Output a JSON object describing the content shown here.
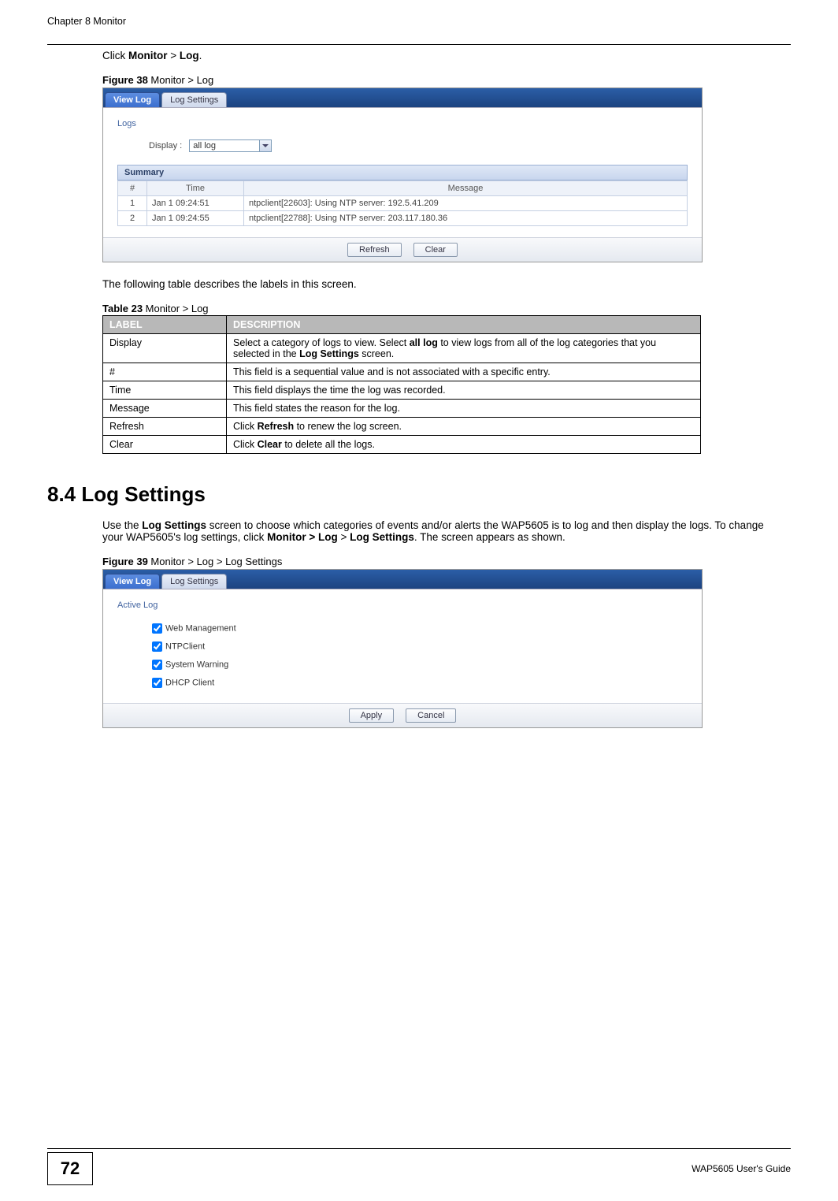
{
  "header": {
    "chapter": "Chapter 8 Monitor"
  },
  "intro": {
    "click_text_prefix": "Click ",
    "click_text_bold1": "Monitor",
    "click_text_mid": " > ",
    "click_text_bold2": "Log",
    "click_text_suffix": "."
  },
  "figure38": {
    "label_prefix": "Figure 38",
    "label_rest": "   Monitor > Log",
    "tabs": {
      "view_log": "View Log",
      "log_settings": "Log Settings"
    },
    "section": "Logs",
    "display_label": "Display :",
    "display_value": "all log",
    "summary": "Summary",
    "columns": {
      "num": "#",
      "time": "Time",
      "message": "Message"
    },
    "rows": [
      {
        "n": "1",
        "time": "Jan 1 09:24:51",
        "msg": "ntpclient[22603]: Using NTP server: 192.5.41.209"
      },
      {
        "n": "2",
        "time": "Jan 1 09:24:55",
        "msg": "ntpclient[22788]: Using NTP server: 203.117.180.36"
      }
    ],
    "buttons": {
      "refresh": "Refresh",
      "clear": "Clear"
    }
  },
  "table_intro": "The following table describes the labels in this screen.",
  "table23": {
    "caption_prefix": "Table 23",
    "caption_rest": "   Monitor > Log",
    "head_label": "LABEL",
    "head_desc": "DESCRIPTION",
    "rows": [
      {
        "label": "Display",
        "desc_pre": "Select a category of logs to view. Select ",
        "desc_b1": "all log",
        "desc_mid": " to view logs from all of the log categories that you selected in the ",
        "desc_b2": "Log Settings",
        "desc_post": " screen."
      },
      {
        "label": "#",
        "desc": "This field is a sequential value and is not associated with a specific entry."
      },
      {
        "label": "Time",
        "desc": "This field displays the time the log was recorded."
      },
      {
        "label": "Message",
        "desc": "This field states the reason for the log."
      },
      {
        "label": "Refresh",
        "desc_pre": "Click ",
        "desc_b1": "Refresh",
        "desc_post": " to renew the log screen."
      },
      {
        "label": "Clear",
        "desc_pre": "Click ",
        "desc_b1": "Clear",
        "desc_post": " to delete all the logs."
      }
    ]
  },
  "section84": {
    "heading": "8.4  Log Settings",
    "p1_pre": "Use the ",
    "p1_b1": "Log Settings",
    "p1_mid": " screen to choose which categories of events and/or alerts the WAP5605 is to log and then display the logs. To change your WAP5605's log settings, click ",
    "p1_b2": "Monitor > Log",
    "p1_mid2": " > ",
    "p1_b3": "Log Settings",
    "p1_post": ". The screen appears as shown."
  },
  "figure39": {
    "label_prefix": "Figure 39",
    "label_rest": "   Monitor > Log > Log Settings",
    "tabs": {
      "view_log": "View Log",
      "log_settings": "Log Settings"
    },
    "section": "Active Log",
    "checks": [
      "Web Management",
      "NTPClient",
      "System Warning",
      "DHCP Client"
    ],
    "buttons": {
      "apply": "Apply",
      "cancel": "Cancel"
    }
  },
  "footer": {
    "page": "72",
    "guide": "WAP5605 User's Guide"
  }
}
